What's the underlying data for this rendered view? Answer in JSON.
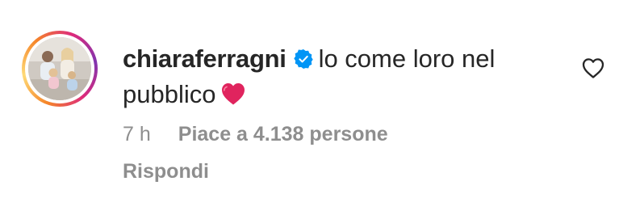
{
  "comment": {
    "username": "chiaraferragni",
    "verified": true,
    "text_line1": "lo come loro nel",
    "text_line2": "pubblico",
    "emoji": "red-heart",
    "time": "7 h",
    "likes": "Piace a 4.138 persone",
    "reply_label": "Rispondi"
  },
  "icons": {
    "verified": "verified-badge-icon",
    "like": "heart-outline-icon"
  },
  "colors": {
    "verified_blue": "#0095f6",
    "heart_red": "#e0245e",
    "meta_gray": "#8e8e8e",
    "text": "#262626"
  }
}
